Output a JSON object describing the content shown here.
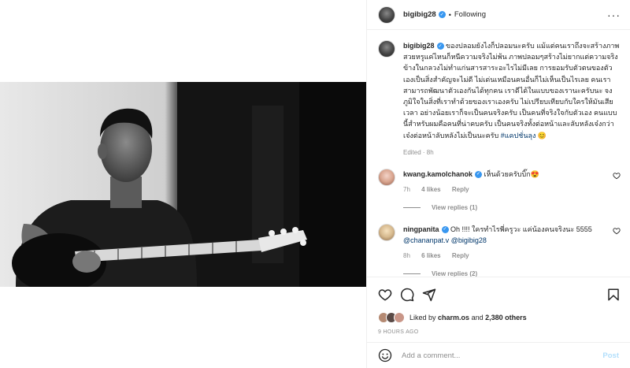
{
  "post": {
    "username": "bigibig28",
    "follow_state": "Following",
    "caption_username": "bigibig28",
    "caption": "ของปลอมยังไงก็ปลอมนะครับ แม้แต่คนเราถึงจะสร้างภาพสวยหรูแค่ไหนก็หนีความจริงไม่พ้น ภาพปลอมๆสร้างไม่ยากแต่ความจริงข้างในกลวงไม่ทำแก่นสารสาระอะไรไม่มีเลย การยอมรับตัวตนของตัวเองเป็นสิ่งสำคัญจะไม่ดี ไม่เด่นเหมือนคนอื่นก็ไม่เห็นเป็นไรเลย คนเราสามารถพัฒนาตัวเองกันได้ทุกคน เราดีได้ในแบบของเรานะครับนะ จงภูมิใจในสิ่งที่เราทำด้วยของเราเองครับ ไม่เปรียบเทียบกับใครให้มันเสียเวลา อย่างน้อยเราก็จะเป็นคนจริงครับ เป็นคนที่จริงใจกับตัวเอง คนแบบนี้สำหรับผมคือคนที่น่าคบครับ เป็นคนจริงทั้งต่อหน้าและลับหลังเจ๋งกว่าเจ๋งต่อหน้าลับหลังไม่เป็นนะครับ",
    "hashtag": "#แคปชั่นลุง",
    "caption_emoji": "😊",
    "edited_meta": "Edited · 8h"
  },
  "comments": [
    {
      "username": "kwang.kamolchanok",
      "verified": true,
      "text": "เห็นด้วยครับบิ๊ก",
      "emoji": "😍",
      "time": "7h",
      "likes": "4 likes",
      "reply": "Reply",
      "view_replies": "View replies (1)"
    },
    {
      "username": "ningpanita",
      "verified": true,
      "text": "Oh !!!! ใครทำไรพี่ครูวะ แค่น้องคนจริงนะ 5555",
      "mention1": "@chananpat.v",
      "mention2": "@bigibig28",
      "time": "8h",
      "likes": "6 likes",
      "reply": "Reply",
      "view_replies": "View replies (2)"
    }
  ],
  "likes": {
    "prefix": "Liked by",
    "user": "charm.os",
    "and": "and",
    "others": "2,380 others"
  },
  "time_ago": "9 HOURS AGO",
  "add_comment": {
    "placeholder": "Add a comment...",
    "post_label": "Post"
  },
  "icons": {
    "verified": "verified-badge-icon",
    "more": "more-options-icon",
    "like": "heart-icon",
    "comment": "comment-icon",
    "share": "share-icon",
    "save": "bookmark-icon",
    "emoji": "emoji-icon"
  },
  "colors": {
    "verified": "#3897f0",
    "link": "#00376b",
    "muted": "#8e8e8e",
    "post_button": "#b2dffc"
  }
}
